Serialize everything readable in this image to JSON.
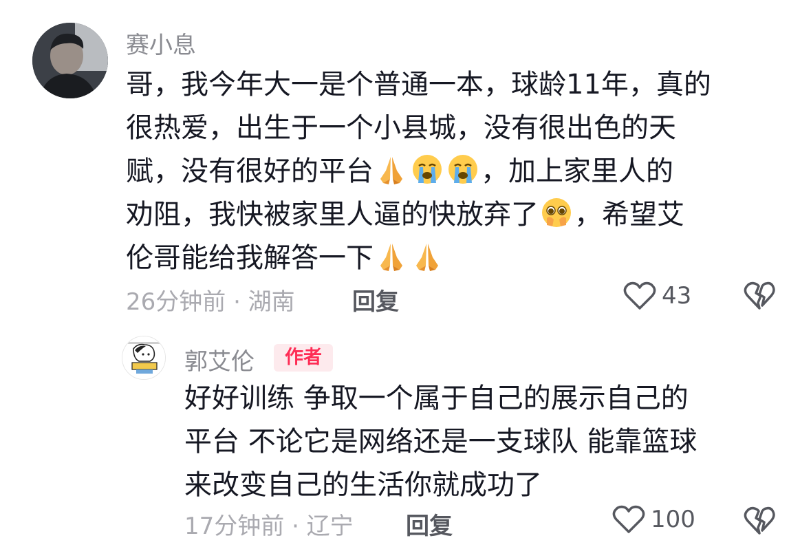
{
  "comments": [
    {
      "username": "赛小息",
      "text_lines": [
        [
          "哥，我今年大一是个普通一本，球龄11年，真的"
        ],
        [
          "很热爱，出生于一个小县城，没有很出色的天"
        ],
        [
          "赋，没有很好的平台",
          "，加上家里人的"
        ],
        [
          "劝阻，我快被家里人逼的快放弃了",
          "，希望艾"
        ],
        [
          "伦哥能给我解答一下"
        ]
      ],
      "emoji_names": [
        "folded-hands",
        "loudly-crying",
        "loudly-crying",
        "pleading-face",
        "folded-hands",
        "folded-hands"
      ],
      "time_location": "26分钟前 · 湖南",
      "reply_label": "回复",
      "like_count": "43"
    },
    {
      "username": "郭艾伦",
      "badge": "作者",
      "text_lines": [
        "好好训练 争取一个属于自己的展示自己的",
        "平台 不论它是网络还是一支球队 能靠篮球",
        "来改变自己的生活你就成功了"
      ],
      "time_location": "17分钟前 · 辽宁",
      "reply_label": "回复",
      "like_count": "100"
    }
  ],
  "colors": {
    "text": "#161823",
    "secondary": "#8a8b91",
    "meta": "#aaaab0",
    "badge_bg": "#fdeaed",
    "badge_text": "#fe2c55"
  }
}
